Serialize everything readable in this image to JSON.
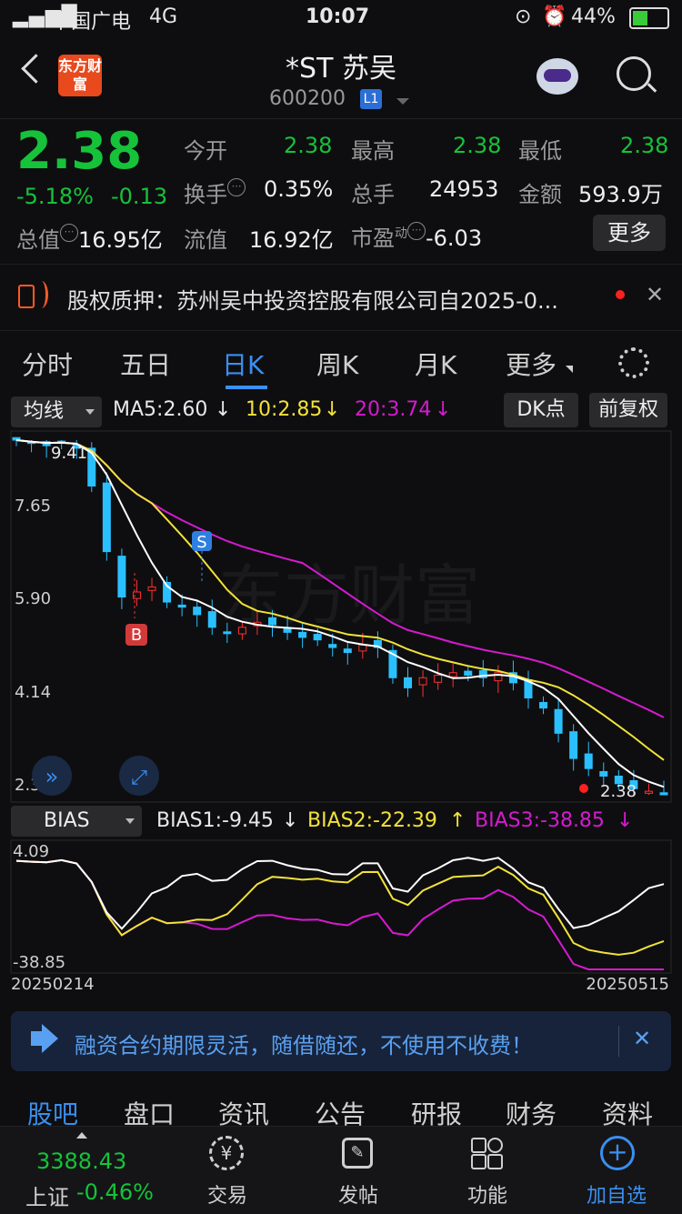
{
  "status_bar": {
    "carrier": "中国广电",
    "network": "4G",
    "time": "10:07",
    "battery": "44%"
  },
  "header": {
    "logo": "东方财富",
    "title": "*ST 苏吴",
    "code": "600200",
    "level": "L1"
  },
  "quote": {
    "price": "2.38",
    "change_pct": "-5.18%",
    "change": "-0.13",
    "labels": {
      "open": "今开",
      "high": "最高",
      "low": "最低",
      "turnover": "换手",
      "volume": "总手",
      "amount": "金额",
      "market_cap": "总值",
      "float_cap": "流值",
      "pe": "市盈",
      "pe_sup": "动"
    },
    "open": "2.38",
    "high": "2.38",
    "low": "2.38",
    "turnover": "0.35%",
    "volume": "24953",
    "amount": "593.9万",
    "market_cap": "16.95亿",
    "float_cap": "16.92亿",
    "pe": "-6.03",
    "more_button": "更多"
  },
  "news": {
    "text": "股权质押：苏州吴中投资控股有限公司自2025-0..."
  },
  "tabs": [
    "分时",
    "五日",
    "日K",
    "周K",
    "月K",
    "更多"
  ],
  "active_tab": "日K",
  "chart_controls": {
    "ma_selector": "均线",
    "ma5": "MA5:2.60",
    "ma10": "10:2.85",
    "ma20": "20:3.74",
    "dk_button": "DK点",
    "adjust_button": "前复权",
    "bias_selector": "BIAS",
    "bias1": "BIAS1:-9.45",
    "bias2": "BIAS2:-22.39",
    "bias3": "BIAS3:-38.85",
    "y_labels": [
      "7.65",
      "5.90",
      "4.14",
      "2.38"
    ],
    "high_marker": "9.41",
    "last_marker": "2.38",
    "bias_top": "4.09",
    "bias_bottom": "-38.85",
    "date_start": "20250214",
    "date_end": "20250515",
    "sell_marker": "S",
    "buy_marker": "B"
  },
  "chart_data": {
    "type": "candlestick",
    "x_range": [
      "20250214",
      "20250515"
    ],
    "ylim": [
      2.38,
      9.41
    ],
    "close": [
      9.41,
      9.35,
      9.3,
      9.38,
      9.25,
      8.5,
      7.2,
      6.3,
      6.4,
      6.5,
      6.2,
      6.1,
      5.95,
      5.7,
      5.6,
      5.7,
      5.8,
      5.75,
      5.6,
      5.5,
      5.45,
      5.3,
      5.2,
      5.35,
      5.3,
      4.7,
      4.5,
      4.7,
      4.75,
      4.8,
      4.75,
      4.7,
      4.8,
      4.6,
      4.3,
      4.1,
      3.6,
      3.1,
      2.9,
      2.75,
      2.6,
      2.5,
      2.45,
      2.38
    ],
    "indicators": {
      "MA5": 2.6,
      "MA10": 2.85,
      "MA20": 3.74,
      "BIAS1": -9.45,
      "BIAS2": -22.39,
      "BIAS3": -38.85
    }
  },
  "promo": {
    "text": "融资合约期限灵活，随借随还，不使用不收费！"
  },
  "bottom_tabs": [
    "股吧",
    "盘口",
    "资讯",
    "公告",
    "研报",
    "财务",
    "资料"
  ],
  "bottom_nav": {
    "index_value": "3388.43",
    "index_name": "上证",
    "index_change": "-0.46%",
    "items": [
      "交易",
      "发帖",
      "功能",
      "加自选"
    ]
  }
}
